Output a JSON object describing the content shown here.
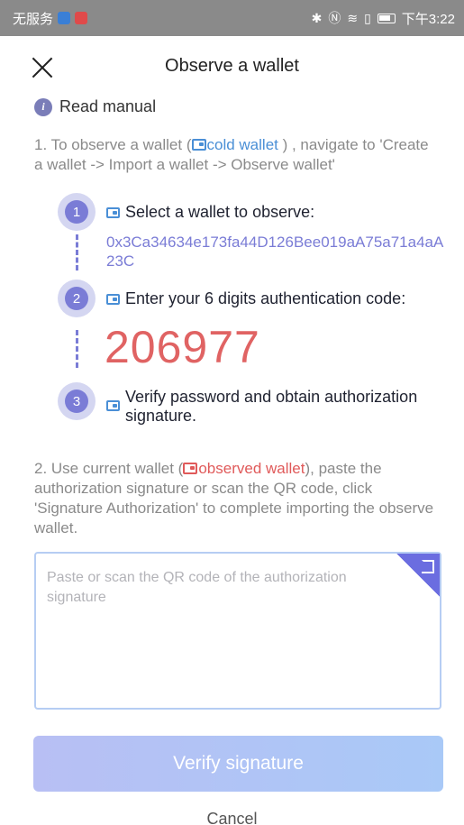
{
  "status_bar": {
    "carrier": "无服务",
    "time": "下午3:22",
    "badge_colors": [
      "#3a7fd6",
      "#e04a4a"
    ]
  },
  "header": {
    "title": "Observe a wallet"
  },
  "manual": {
    "label": "Read manual",
    "icon": "info-icon"
  },
  "step1_text": {
    "prefix": "1. To observe a wallet (",
    "highlight": "cold wallet",
    "suffix": " ) , navigate to 'Create a wallet -> Import a wallet -> Observe wallet'"
  },
  "steps": [
    {
      "number": "1",
      "text": "Select a wallet to observe:"
    },
    {
      "number": "2",
      "text": "Enter your 6 digits authentication code:"
    },
    {
      "number": "3",
      "text": "Verify password and obtain authorization signature."
    }
  ],
  "wallet_address": "0x3Ca34634e173fa44D126Bee019aA75a71a4aA23C",
  "auth_code": "206977",
  "step2_text": {
    "prefix": "2. Use current wallet (",
    "highlight": "observed wallet",
    "suffix": "), paste the authorization signature or scan the QR code, click 'Signature Authorization' to complete importing the observe wallet."
  },
  "signature_input": {
    "placeholder": "Paste or scan the QR code of the authorization signature"
  },
  "buttons": {
    "verify": "Verify signature",
    "cancel": "Cancel"
  },
  "colors": {
    "accent": "#7a7cd6",
    "link_blue": "#4a8fd6",
    "code_red": "#e06363",
    "button_gradient": [
      "#b8bff4",
      "#a9c9f7"
    ]
  }
}
